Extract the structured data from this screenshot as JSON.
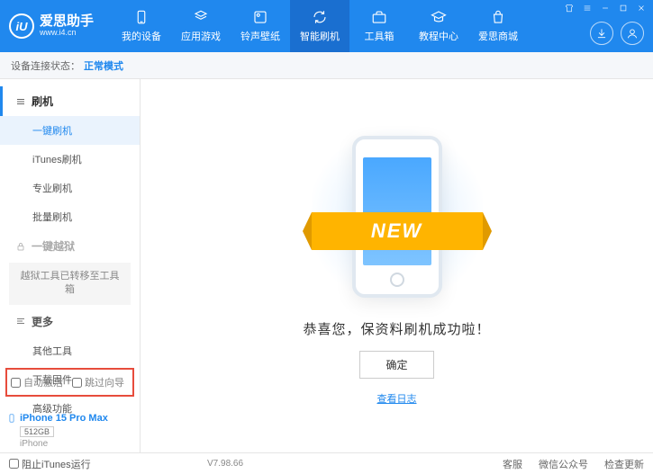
{
  "app": {
    "title": "爱思助手",
    "url": "www.i4.cn",
    "logo_letter": "iU"
  },
  "nav": [
    {
      "label": "我的设备"
    },
    {
      "label": "应用游戏"
    },
    {
      "label": "铃声壁纸"
    },
    {
      "label": "智能刷机"
    },
    {
      "label": "工具箱"
    },
    {
      "label": "教程中心"
    },
    {
      "label": "爱思商城"
    }
  ],
  "status": {
    "label": "设备连接状态：",
    "mode": "正常模式"
  },
  "sidebar": {
    "flash_header": "刷机",
    "items": [
      {
        "label": "一键刷机"
      },
      {
        "label": "iTunes刷机"
      },
      {
        "label": "专业刷机"
      },
      {
        "label": "批量刷机"
      }
    ],
    "jailbreak_header": "一键越狱",
    "jailbreak_note": "越狱工具已转移至工具箱",
    "more_header": "更多",
    "more_items": [
      {
        "label": "其他工具"
      },
      {
        "label": "下载固件"
      },
      {
        "label": "高级功能"
      }
    ],
    "checkboxes": {
      "auto_activate": "自动激活",
      "skip_guide": "跳过向导"
    }
  },
  "device": {
    "name": "iPhone 15 Pro Max",
    "storage": "512GB",
    "model": "iPhone"
  },
  "main": {
    "banner": "NEW",
    "success": "恭喜您，保资料刷机成功啦！",
    "ok": "确定",
    "log": "查看日志"
  },
  "footer": {
    "block_itunes": "阻止iTunes运行",
    "version": "V7.98.66",
    "links": [
      "客服",
      "微信公众号",
      "检查更新"
    ]
  }
}
